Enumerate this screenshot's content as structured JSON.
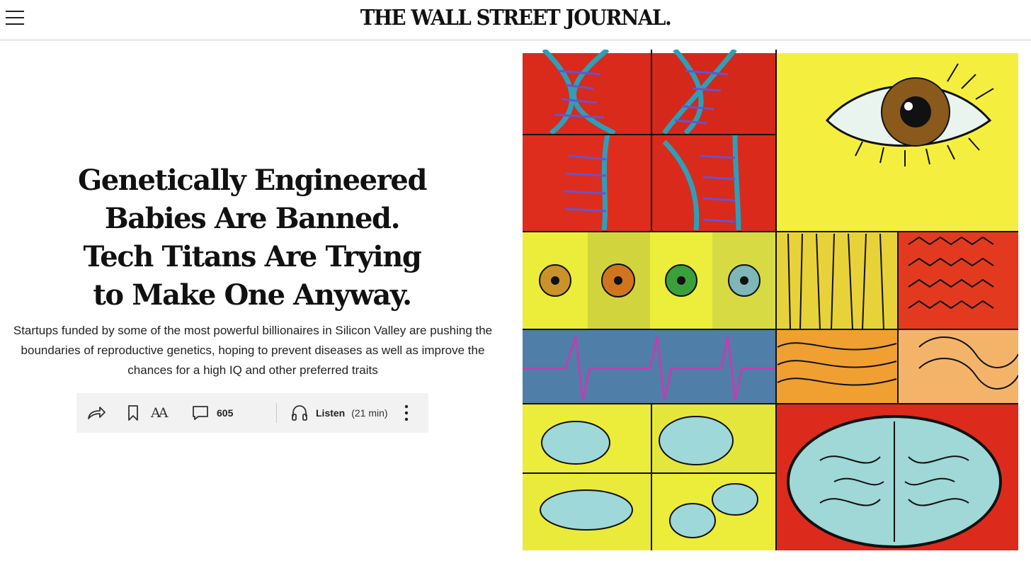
{
  "header": {
    "masthead": "THE WALL STREET JOURNAL."
  },
  "article": {
    "headline": "Genetically Engineered Babies Are Banned. Tech Titans Are Trying to Make One Anyway.",
    "dek": "Startups funded by some of the most powerful billionaires in Silicon Valley are pushing the boundaries of reproductive genetics, hoping to prevent diseases as well as improve the chances for a high IQ and other preferred traits"
  },
  "toolbar": {
    "comment_count": "605",
    "listen_label": "Listen",
    "listen_duration": "(21 min)",
    "text_size_glyph": "AA",
    "icons": [
      "share-icon",
      "bookmark-icon",
      "text-size-icon",
      "comment-icon",
      "headphones-icon",
      "more-vertical-icon"
    ]
  },
  "colors": {
    "toolbar_bg": "#f2f2f2",
    "art_red": "#d92a1c",
    "art_yellow": "#f2ee3c",
    "art_olive_yellow": "#d7d946",
    "art_blue": "#4f7fa8",
    "art_orange": "#f09a30",
    "art_cyan": "#8fd3d6"
  }
}
